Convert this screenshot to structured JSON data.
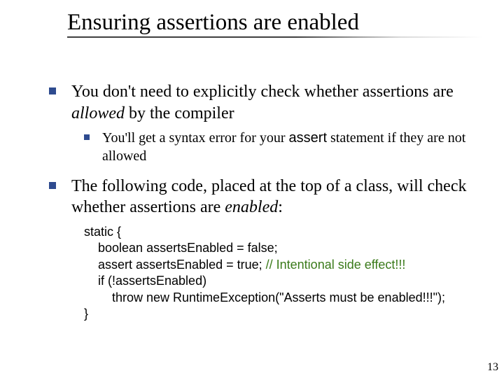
{
  "title": "Ensuring assertions are enabled",
  "bullets": {
    "b1_pre": "You don't need to explicitly check whether assertions are ",
    "b1_em": "allowed",
    "b1_post": " by the compiler",
    "b1a_pre": "You'll get a syntax error for your ",
    "b1a_code": "assert",
    "b1a_post": " statement if they are not allowed",
    "b2_pre": "The following code, placed at the top of a class, will check whether assertions are ",
    "b2_em": "enabled",
    "b2_post": ":"
  },
  "code": {
    "l1": "static {",
    "l2": "    boolean assertsEnabled = false;",
    "l3a": "    assert assertsEnabled = true; ",
    "l3comment": "// Intentional side effect!!!",
    "l4": "    if (!assertsEnabled)",
    "l5": "        throw new RuntimeException(\"Asserts must be enabled!!!\");",
    "l6": "}"
  },
  "page_number": "13"
}
